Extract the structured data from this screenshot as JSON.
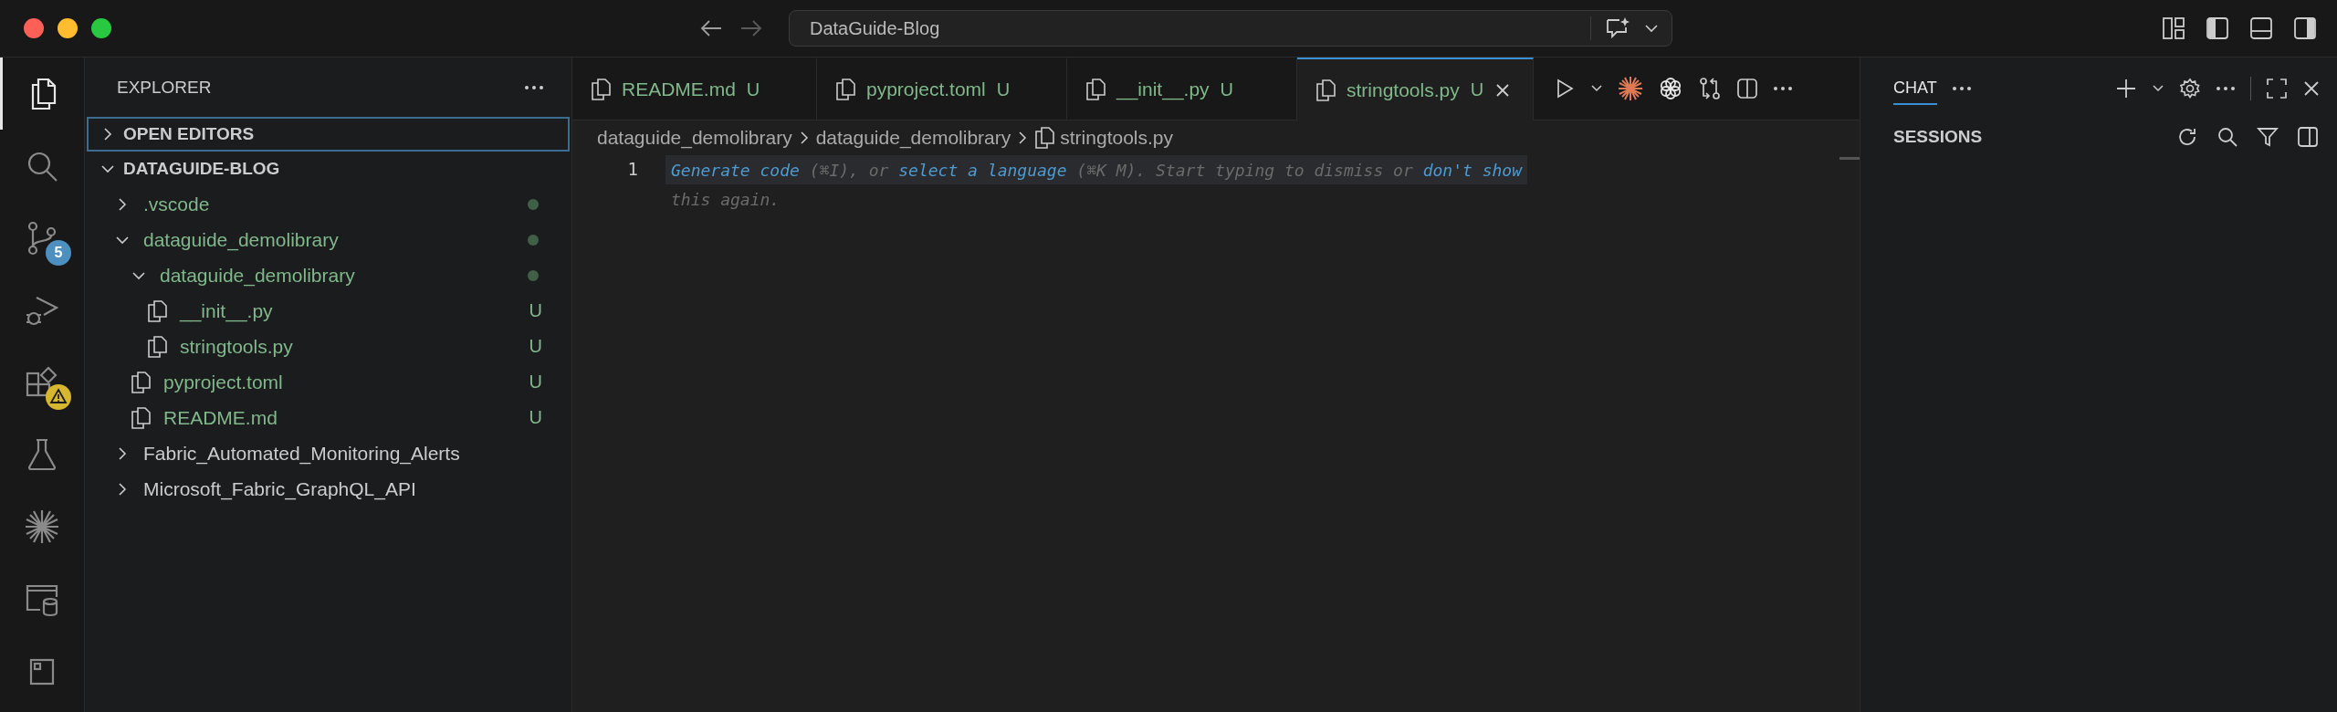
{
  "window": {
    "title": "DataGuide-Blog"
  },
  "activity_bar": {
    "items": [
      {
        "kind": "explorer",
        "selected": true
      },
      {
        "kind": "search",
        "selected": false
      },
      {
        "kind": "source-control",
        "selected": false,
        "badge": "5"
      },
      {
        "kind": "run-debug",
        "selected": false
      },
      {
        "kind": "extensions",
        "selected": false,
        "warning": true
      },
      {
        "kind": "testing",
        "selected": false
      },
      {
        "kind": "starburst",
        "selected": false
      },
      {
        "kind": "database",
        "selected": false
      },
      {
        "kind": "panel",
        "selected": false
      }
    ]
  },
  "sidebar": {
    "title": "EXPLORER",
    "sections": [
      {
        "title": "OPEN EDITORS",
        "expanded": false,
        "focused": true
      },
      {
        "title": "DATAGUIDE-BLOG",
        "expanded": true,
        "focused": false,
        "tree": [
          {
            "name": ".vscode",
            "kind": "folder",
            "expanded": false,
            "changed": true,
            "dot": true
          },
          {
            "name": "dataguide_demolibrary",
            "kind": "folder",
            "expanded": true,
            "changed": true,
            "dot": true,
            "children": [
              {
                "name": "dataguide_demolibrary",
                "kind": "folder",
                "expanded": true,
                "changed": true,
                "dot": true,
                "children": [
                  {
                    "name": "__init__.py",
                    "kind": "file",
                    "changed": true,
                    "status": "U"
                  },
                  {
                    "name": "stringtools.py",
                    "kind": "file",
                    "changed": true,
                    "status": "U"
                  }
                ]
              },
              {
                "name": "pyproject.toml",
                "kind": "file",
                "changed": true,
                "status": "U"
              },
              {
                "name": "README.md",
                "kind": "file",
                "changed": true,
                "status": "U"
              }
            ]
          },
          {
            "name": "Fabric_Automated_Monitoring_Alerts",
            "kind": "folder",
            "expanded": false,
            "changed": false,
            "dot": false
          },
          {
            "name": "Microsoft_Fabric_GraphQL_API",
            "kind": "folder",
            "expanded": false,
            "changed": false,
            "dot": false
          }
        ]
      }
    ]
  },
  "editor": {
    "tabs": [
      {
        "label": "README.md",
        "status": "U",
        "selected": false
      },
      {
        "label": "pyproject.toml",
        "status": "U",
        "selected": false
      },
      {
        "label": "__init__.py",
        "status": "U",
        "selected": false
      },
      {
        "label": "stringtools.py",
        "status": "U",
        "selected": true
      }
    ],
    "breadcrumb": [
      "dataguide_demolibrary",
      "dataguide_demolibrary",
      "stringtools.py"
    ],
    "line_number": "1",
    "hint_lines": [
      [
        {
          "kind": "link",
          "text": "Generate code"
        },
        {
          "kind": "text",
          "text": " (⌘I), or "
        },
        {
          "kind": "link",
          "text": "select a language"
        },
        {
          "kind": "text",
          "text": " (⌘K M). Start typing to dismiss or "
        },
        {
          "kind": "link",
          "text": "don't show"
        }
      ],
      [
        {
          "kind": "text",
          "text": "this again."
        }
      ]
    ]
  },
  "chat": {
    "tabs": [
      {
        "label": "CHAT",
        "selected": true
      }
    ],
    "section": "SESSIONS"
  }
}
